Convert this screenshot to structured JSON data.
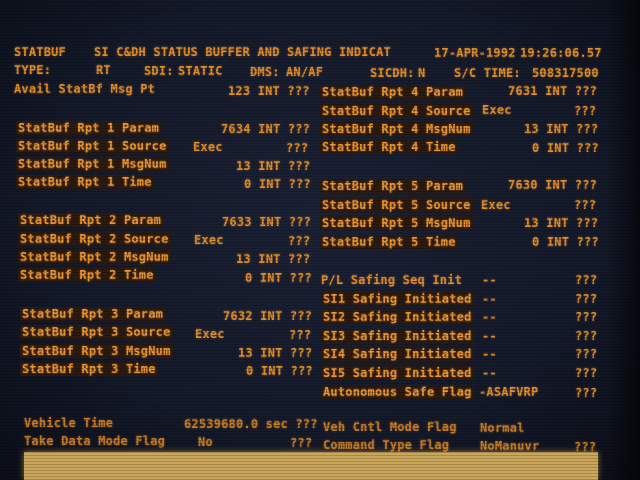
{
  "header": {
    "id": "STATBUF",
    "title": "SI C&DH STATUS BUFFER AND SAFING INDICAT",
    "date": "17-APR-1992",
    "time": "19:26:06.57",
    "type_label": "TYPE:",
    "type_value": "RT",
    "sdi_label": "SDI:",
    "sdi_value": "STATIC",
    "dms_label": "DMS:",
    "dms_value": "AN/AF",
    "sicdh_label": "SICDH:",
    "sicdh_value": "N",
    "sctime_label": "S/C TIME:",
    "sctime_value": "508317500"
  },
  "left": {
    "avail": {
      "label": "Avail StatBf Msg Pt",
      "value": "123 INT ???"
    },
    "rpt1": [
      {
        "label": "StatBuf Rpt 1 Param",
        "value": "7634 INT ???"
      },
      {
        "label": "StatBuf Rpt 1 Source",
        "src": "Exec",
        "value": "???"
      },
      {
        "label": "StatBuf Rpt 1 MsgNum",
        "value": "13 INT ???"
      },
      {
        "label": "StatBuf Rpt 1 Time",
        "value": "0 INT ???"
      }
    ],
    "rpt2": [
      {
        "label": "StatBuf Rpt 2 Param",
        "value": "7633 INT ???"
      },
      {
        "label": "StatBuf Rpt 2 Source",
        "src": "Exec",
        "value": "???"
      },
      {
        "label": "StatBuf Rpt 2 MsgNum",
        "value": "13 INT ???"
      },
      {
        "label": "StatBuf Rpt 2 Time",
        "value": "0 INT ???"
      }
    ],
    "rpt3": [
      {
        "label": "StatBuf Rpt 3 Param",
        "value": "7632 INT ???"
      },
      {
        "label": "StatBuf Rpt 3 Source",
        "src": "Exec",
        "value": "???"
      },
      {
        "label": "StatBuf Rpt 3 MsgNum",
        "value": "13 INT ???"
      },
      {
        "label": "StatBuf Rpt 3 Time",
        "value": "0 INT ???"
      }
    ]
  },
  "right": {
    "rpt4": [
      {
        "label": "StatBuf Rpt 4 Param",
        "value": "7631 INT ???"
      },
      {
        "label": "StatBuf Rpt 4 Source",
        "src": "Exec",
        "value": "???"
      },
      {
        "label": "StatBuf Rpt 4 MsgNum",
        "value": "13 INT ???"
      },
      {
        "label": "StatBuf Rpt 4 Time",
        "value": "0 INT ???"
      }
    ],
    "rpt5": [
      {
        "label": "StatBuf Rpt 5 Param",
        "value": "7630 INT ???"
      },
      {
        "label": "StatBuf Rpt 5 Source",
        "src": "Exec",
        "value": "???"
      },
      {
        "label": "StatBuf Rpt 5 MsgNum",
        "value": "13 INT ???"
      },
      {
        "label": "StatBuf Rpt 5 Time",
        "value": "0 INT ???"
      }
    ],
    "safing": [
      {
        "label": "P/L Safing Seq Init",
        "src": "--",
        "value": "???"
      },
      {
        "label": "SI1 Safing Initiated",
        "src": "--",
        "value": "???"
      },
      {
        "label": "SI2 Safing Initiated",
        "src": "--",
        "value": "???"
      },
      {
        "label": "SI3 Safing Initiated",
        "src": "--",
        "value": "???"
      },
      {
        "label": "SI4 Safing Initiated",
        "src": "--",
        "value": "???"
      },
      {
        "label": "SI5 Safing Initiated",
        "src": "--",
        "value": "???"
      },
      {
        "label": "Autonomous Safe Flag",
        "src": "-ASAFVRP",
        "value": "???"
      }
    ]
  },
  "footer": {
    "veh_time_label": "Vehicle Time",
    "veh_time_value": "62539680.0 sec ???",
    "take_data_label": "Take Data Mode Flag",
    "take_data_src": "No",
    "take_data_value": "???",
    "veh_cntl_label": "Veh Cntl Mode Flag",
    "veh_cntl_value": "Normal",
    "cmd_type_label": "Command Type Flag",
    "cmd_type_src": "NoManuvr",
    "cmd_type_value": "???"
  }
}
